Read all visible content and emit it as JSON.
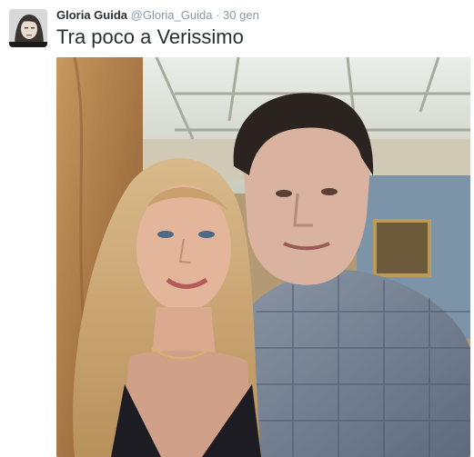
{
  "tweet": {
    "author_name": "Gloria Guida",
    "author_handle": "@Gloria_Guida",
    "separator": "·",
    "timestamp": "30 gen",
    "text": "Tra poco a Verissimo",
    "avatar_icon": "profile-photo",
    "media_icon": "photo"
  },
  "colors": {
    "name": "#292f33",
    "secondary": "#8899a6"
  }
}
